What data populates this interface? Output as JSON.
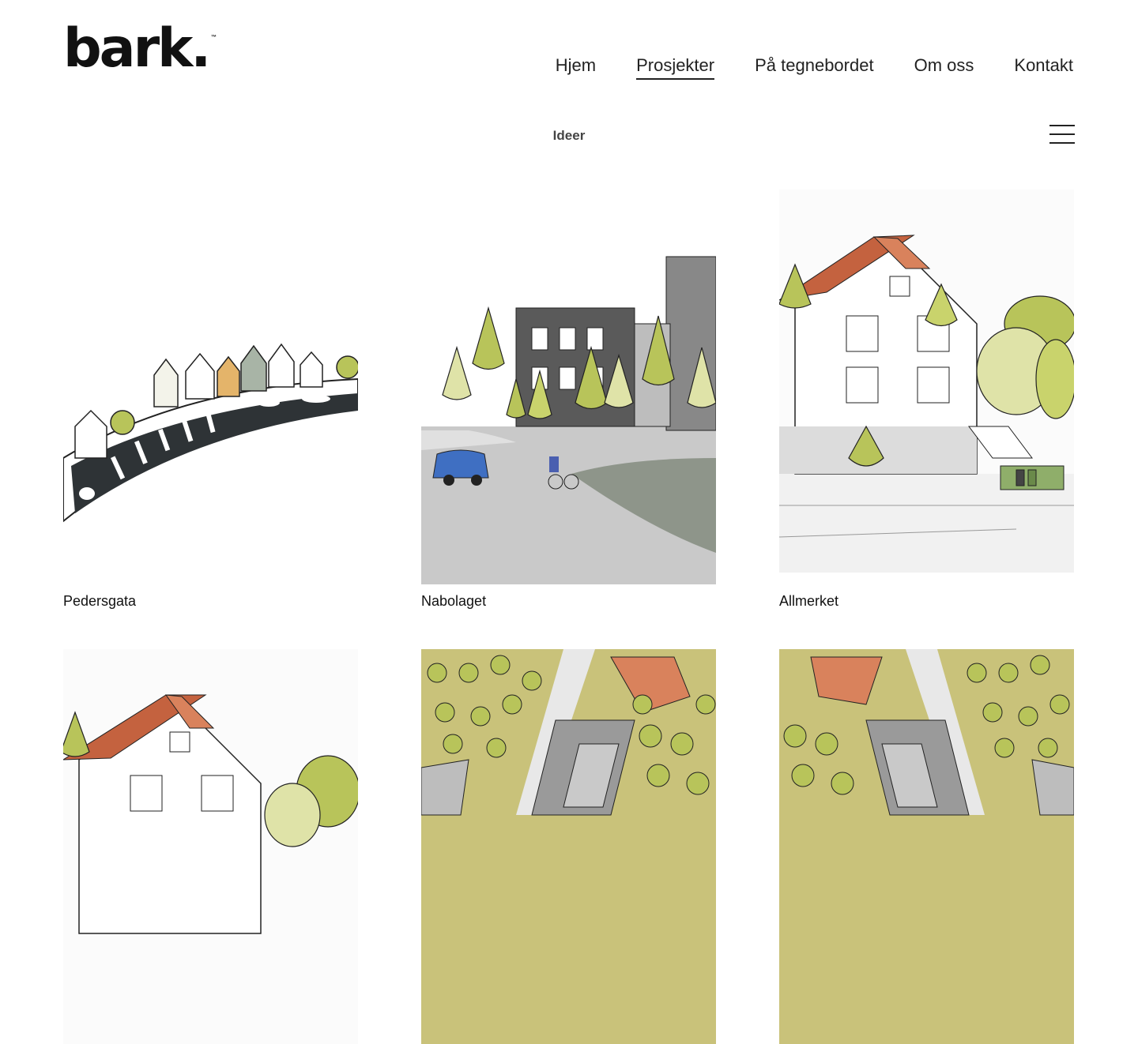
{
  "header": {
    "logo_text": "bark.",
    "logo_tm": "™",
    "nav": [
      {
        "label": "Hjem",
        "active": false
      },
      {
        "label": "Prosjekter",
        "active": true
      },
      {
        "label": "På tegnebordet",
        "active": false
      },
      {
        "label": "Om oss",
        "active": false
      },
      {
        "label": "Kontakt",
        "active": false
      }
    ]
  },
  "filter": {
    "label": "Ideer",
    "menu_icon": "hamburger-icon"
  },
  "projects": [
    {
      "title": "Pedersgata",
      "image": "street-illustration"
    },
    {
      "title": "Nabolaget",
      "image": "neighborhood-illustration"
    },
    {
      "title": "Allmerket",
      "image": "house-illustration"
    },
    {
      "title": "",
      "image": "house-illustration"
    },
    {
      "title": "",
      "image": "aerial-illustration"
    },
    {
      "title": "",
      "image": "aerial-illustration"
    }
  ],
  "colors": {
    "text": "#111111",
    "roof": "#c4623f",
    "tree_green": "#b8c45a",
    "tree_light": "#dfe3a8",
    "building_dark": "#5a5a5a",
    "road": "#c9c9c9"
  }
}
